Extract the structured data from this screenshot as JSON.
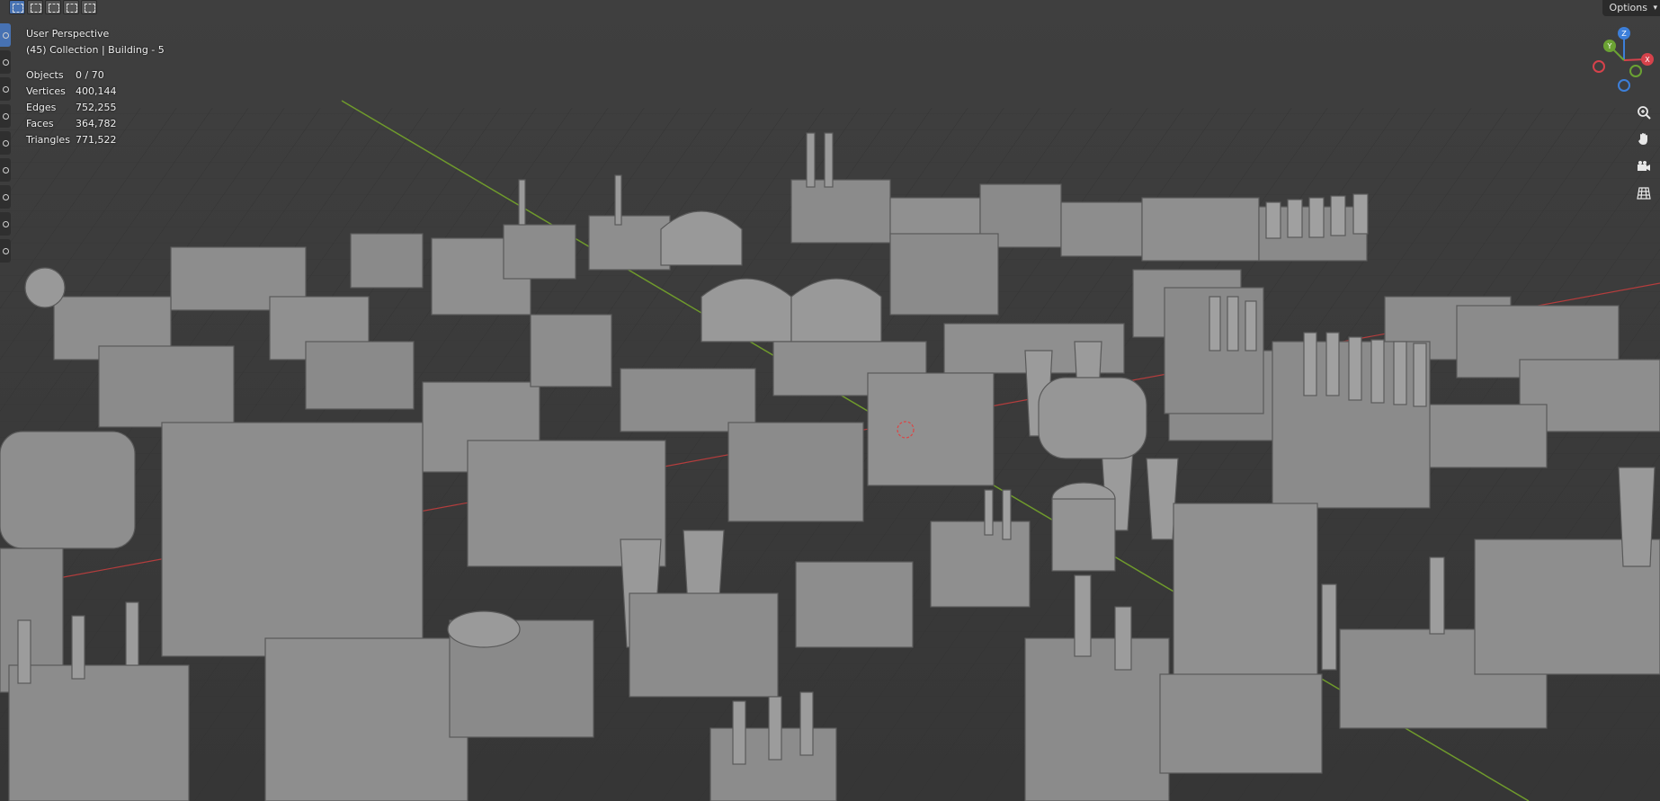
{
  "viewport": {
    "title": "User Perspective",
    "subtitle": "(45) Collection | Building - 5",
    "stats": [
      {
        "label": "Objects",
        "value": "0 / 70"
      },
      {
        "label": "Vertices",
        "value": "400,144"
      },
      {
        "label": "Edges",
        "value": "752,255"
      },
      {
        "label": "Faces",
        "value": "364,782"
      },
      {
        "label": "Triangles",
        "value": "771,522"
      }
    ]
  },
  "header": {
    "options_label": "Options",
    "select_modes": [
      "select-new-icon",
      "select-extend-icon",
      "select-subtract-icon",
      "select-invert-icon",
      "select-intersect-icon"
    ]
  },
  "gizmo": {
    "axis_z": "Z",
    "axis_y": "Y",
    "axis_x": "X",
    "colors": {
      "x": "#d6424b",
      "y": "#6ba233",
      "z": "#3d7fd9"
    }
  },
  "nav_tools": [
    "zoom-icon",
    "pan-hand-icon",
    "camera-view-icon",
    "ortho-grid-icon"
  ],
  "colors": {
    "background": "#3b3b3b",
    "grid": "#333333",
    "x_axis": "#b43d3d",
    "y_axis": "#6f9a2c",
    "model": "#8f8f8f",
    "accent": "#4772b3"
  }
}
